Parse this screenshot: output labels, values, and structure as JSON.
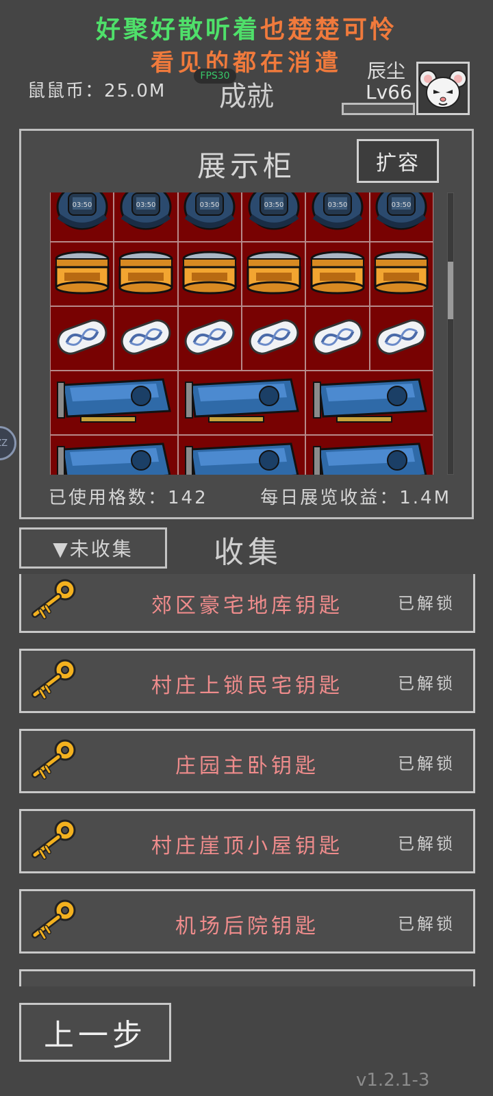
{
  "banner": {
    "line1_green": "好聚好散听着",
    "line1_orange": "也楚楚可怜",
    "line2": "看见的都在消遣"
  },
  "header": {
    "currency_label": "鼠鼠币：",
    "currency_value": "25.0M",
    "fps": "FPS30",
    "title": "成就",
    "player_name": "辰尘",
    "player_level": "Lv66",
    "xp_progress": 0.0,
    "avatar_icon": "white-mouse-avatar-icon"
  },
  "cabinet": {
    "title": "展示柜",
    "expand_label": "扩容",
    "rows": [
      {
        "item": "smartwatch-icon",
        "count": 6,
        "wide": false
      },
      {
        "item": "gold-jar-icon",
        "count": 6,
        "wide": false
      },
      {
        "item": "dna-capsule-icon",
        "count": 6,
        "wide": false
      },
      {
        "item": "graphics-card-icon",
        "count": 3,
        "wide": true
      },
      {
        "item": "graphics-card-icon",
        "count": 3,
        "wide": true
      }
    ],
    "used_label": "已使用格数：",
    "used_value": "142",
    "income_label": "每日展览收益：",
    "income_value": "1.4M",
    "bg_color": "#780202"
  },
  "side_tab": {
    "label": "ZZ"
  },
  "collection": {
    "filter_label": "▼未收集",
    "title": "收集",
    "items": [
      {
        "name": "郊区豪宅地库钥匙",
        "status": "已解锁"
      },
      {
        "name": "村庄上锁民宅钥匙",
        "status": "已解锁"
      },
      {
        "name": "庄园主卧钥匙",
        "status": "已解锁"
      },
      {
        "name": "村庄崖顶小屋钥匙",
        "status": "已解锁"
      },
      {
        "name": "机场后院钥匙",
        "status": "已解锁"
      }
    ]
  },
  "footer": {
    "back_label": "上一步",
    "version": "v1.2.1-3"
  }
}
